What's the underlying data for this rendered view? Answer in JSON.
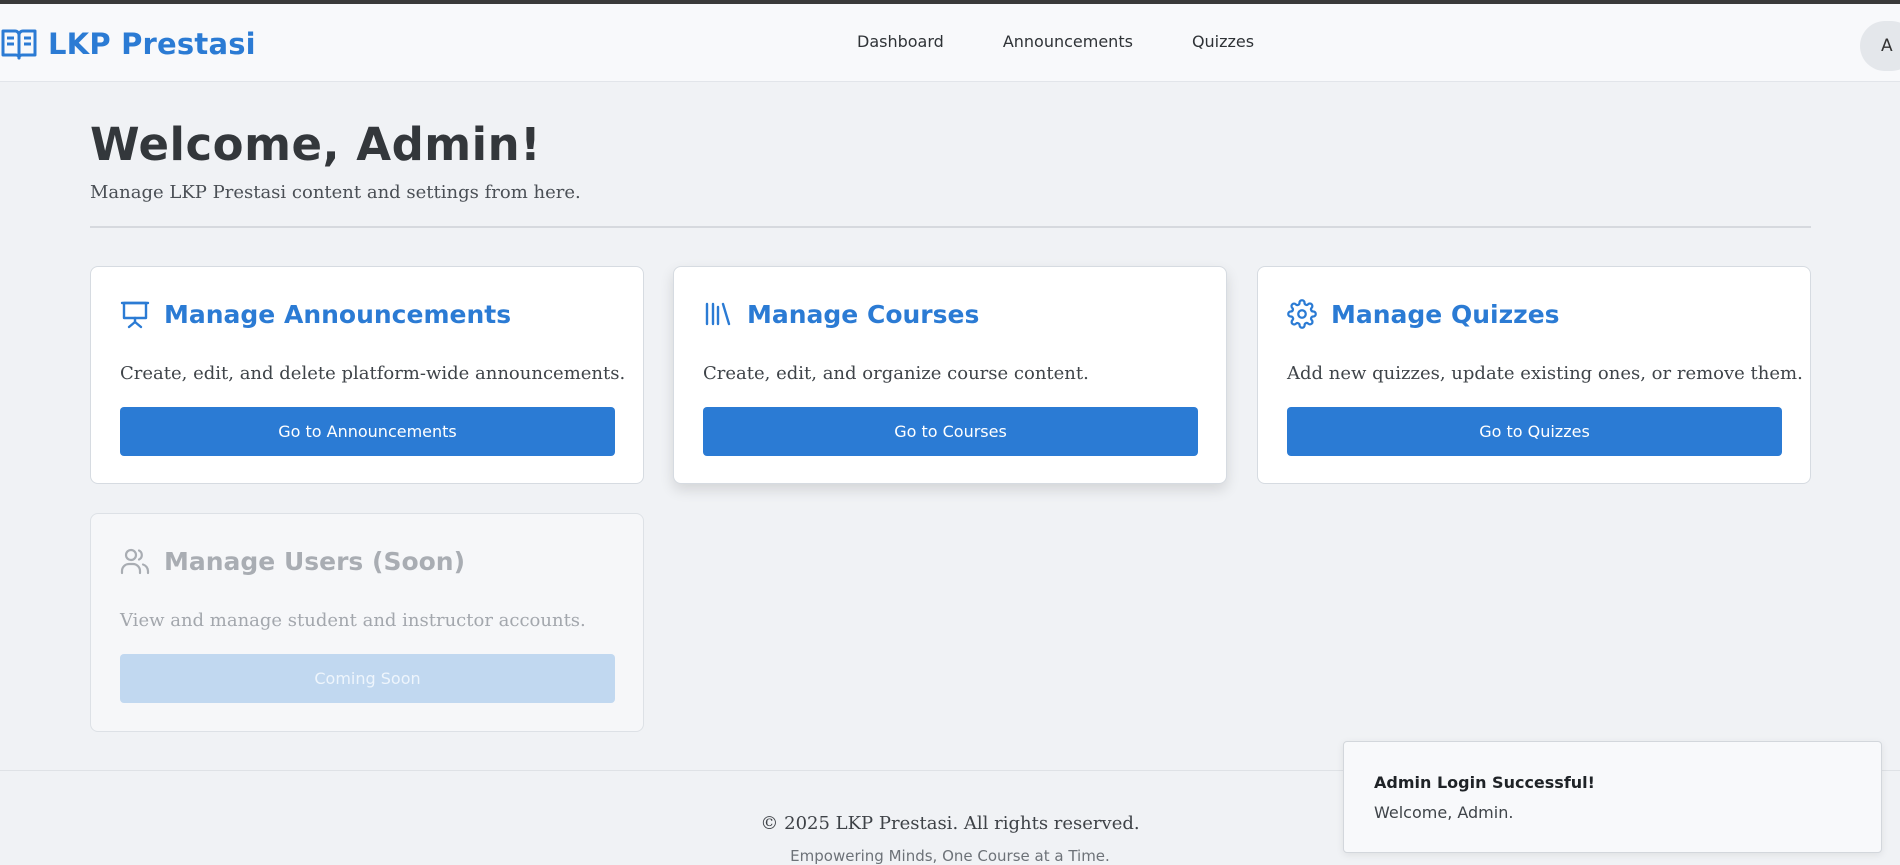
{
  "header": {
    "brand": "LKP Prestasi",
    "nav": [
      "Dashboard",
      "Announcements",
      "Quizzes"
    ],
    "avatar_initial": "A"
  },
  "welcome": {
    "title": "Welcome, Admin!",
    "subtitle": "Manage LKP Prestasi content and settings from here."
  },
  "cards": [
    {
      "icon": "presentation-board-icon",
      "title": "Manage Announcements",
      "description": "Create, edit, and delete platform-wide announcements.",
      "button": "Go to Announcements",
      "enabled": true
    },
    {
      "icon": "library-books-icon",
      "title": "Manage Courses",
      "description": "Create, edit, and organize course content.",
      "button": "Go to Courses",
      "enabled": true
    },
    {
      "icon": "gear-icon",
      "title": "Manage Quizzes",
      "description": "Add new quizzes, update existing ones, or remove them.",
      "button": "Go to Quizzes",
      "enabled": true
    },
    {
      "icon": "users-icon",
      "title": "Manage Users (Soon)",
      "description": "View and manage student and instructor accounts.",
      "button": "Coming Soon",
      "enabled": false
    }
  ],
  "footer": {
    "copyright": "© 2025 LKP Prestasi. All rights reserved.",
    "tagline": "Empowering Minds, One Course at a Time."
  },
  "toast": {
    "title": "Admin Login Successful!",
    "message": "Welcome, Admin."
  },
  "colors": {
    "accent": "#2b7bd4",
    "background": "#f0f2f5",
    "disabled_button": "#c1d8f0"
  }
}
